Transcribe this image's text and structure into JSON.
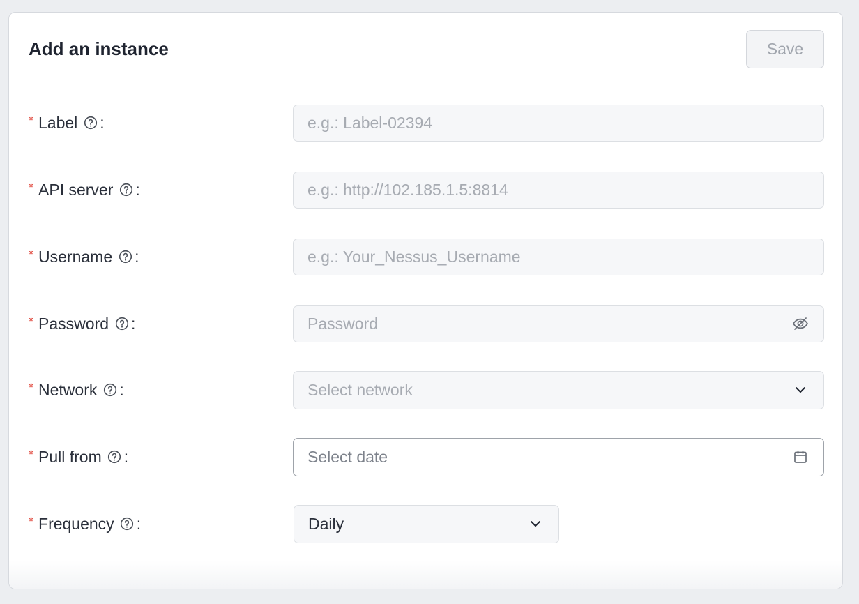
{
  "form": {
    "title": "Add an instance",
    "save_label": "Save",
    "fields": [
      {
        "label": "Label",
        "placeholder": "e.g.: Label-02394"
      },
      {
        "label": "API server",
        "placeholder": "e.g.: http://102.185.1.5:8814"
      },
      {
        "label": "Username",
        "placeholder": "e.g.: Your_Nessus_Username"
      },
      {
        "label": "Password",
        "placeholder": "Password"
      },
      {
        "label": "Network",
        "placeholder": "Select network"
      },
      {
        "label": "Pull from",
        "placeholder": "Select date"
      },
      {
        "label": "Frequency",
        "value": "Daily"
      }
    ]
  },
  "symbols": {
    "required": "*",
    "colon": ":"
  },
  "icons": {
    "help": "question-circle-icon",
    "password_toggle": "eye-slash-icon",
    "select": "chevron-down-icon",
    "date": "calendar-icon"
  },
  "colors": {
    "required": "#e0453a",
    "text": "#1f2430",
    "placeholder": "#a7abb2",
    "field_bg": "#f6f7f9",
    "border": "#dcdfe3"
  }
}
